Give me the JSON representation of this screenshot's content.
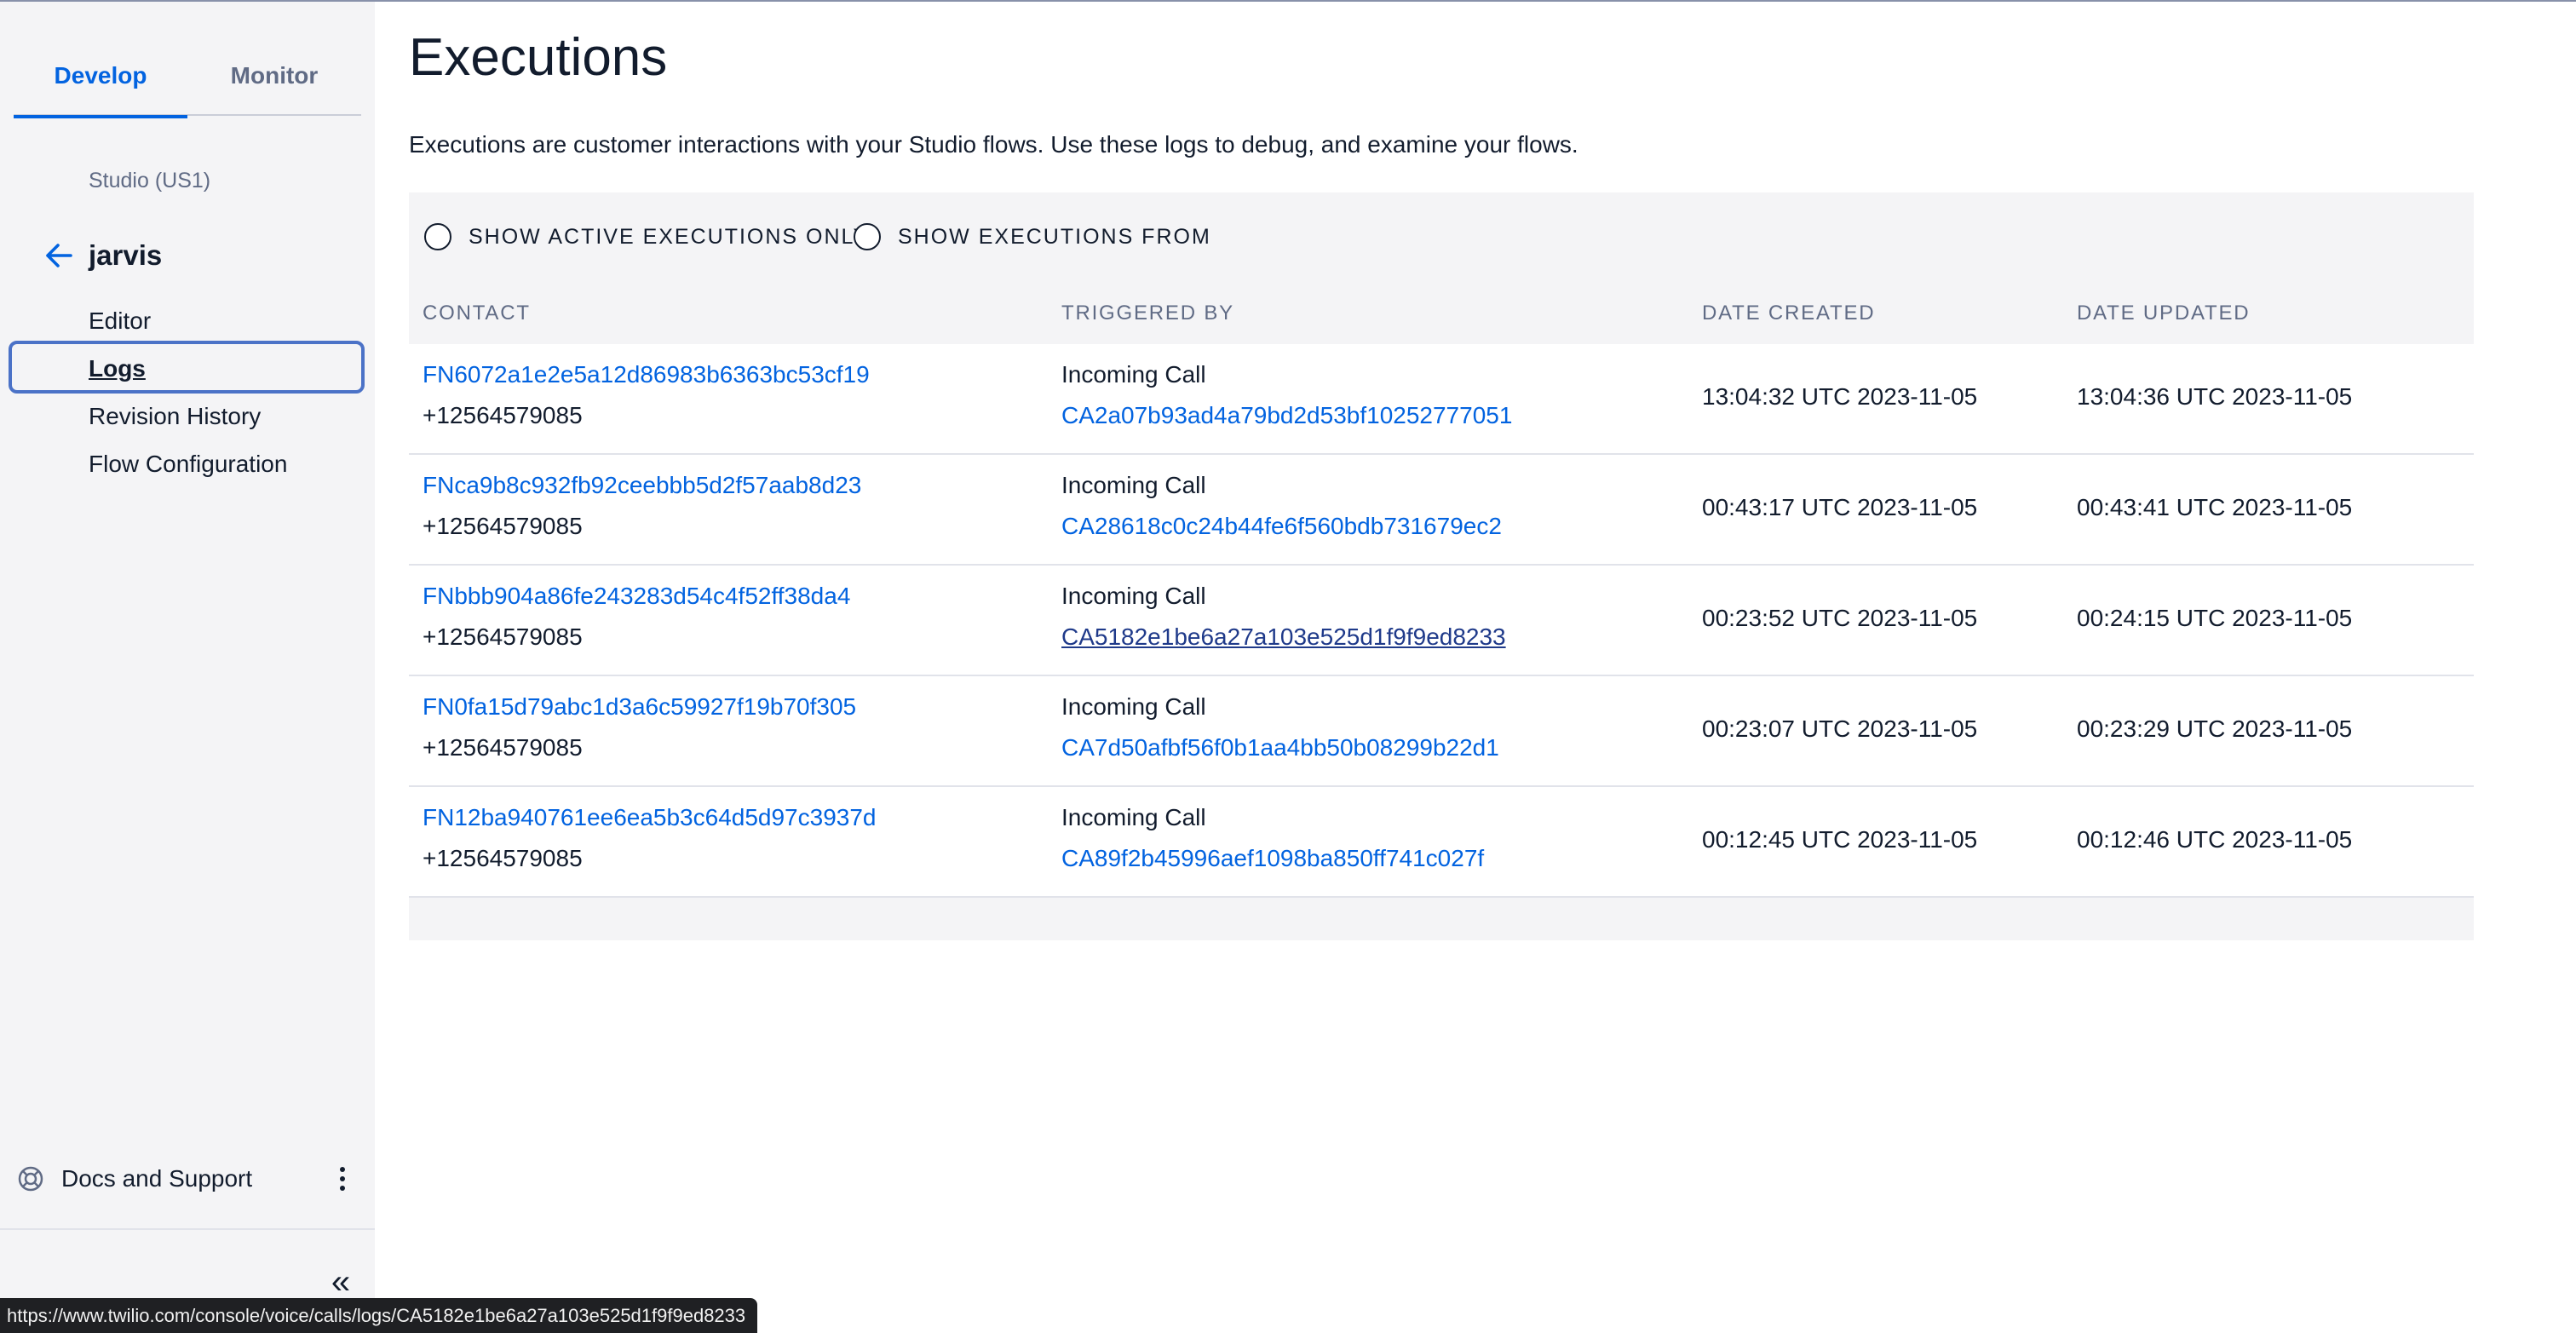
{
  "sidebar": {
    "tabs": [
      {
        "label": "Develop",
        "active": true
      },
      {
        "label": "Monitor",
        "active": false
      }
    ],
    "region": "Studio (US1)",
    "flow_name": "jarvis",
    "nav": [
      {
        "label": "Editor",
        "active": false
      },
      {
        "label": "Logs",
        "active": true
      },
      {
        "label": "Revision History",
        "active": false
      },
      {
        "label": "Flow Configuration",
        "active": false
      }
    ],
    "docs_label": "Docs and Support",
    "collapse_glyph": "«"
  },
  "main": {
    "title": "Executions",
    "description": "Executions are customer interactions with your Studio flows. Use these logs to debug, and examine your flows.",
    "filters": {
      "active_only": "SHOW ACTIVE EXECUTIONS ONLY",
      "from": "SHOW EXECUTIONS FROM"
    },
    "columns": [
      "CONTACT",
      "TRIGGERED BY",
      "DATE CREATED",
      "DATE UPDATED"
    ],
    "rows": [
      {
        "sid": "FN6072a1e2e5a12d86983b6363bc53cf19",
        "contact": "+12564579085",
        "trigger_type": "Incoming Call",
        "call_sid": "CA2a07b93ad4a79bd2d53bf10252777051",
        "created": "13:04:32 UTC 2023-11-05",
        "updated": "13:04:36 UTC 2023-11-05"
      },
      {
        "sid": "FNca9b8c932fb92ceebbb5d2f57aab8d23",
        "contact": "+12564579085",
        "trigger_type": "Incoming Call",
        "call_sid": "CA28618c0c24b44fe6f560bdb731679ec2",
        "created": "00:43:17 UTC 2023-11-05",
        "updated": "00:43:41 UTC 2023-11-05"
      },
      {
        "sid": "FNbbb904a86fe243283d54c4f52ff38da4",
        "contact": "+12564579085",
        "trigger_type": "Incoming Call",
        "call_sid": "CA5182e1be6a27a103e525d1f9f9ed8233",
        "created": "00:23:52 UTC 2023-11-05",
        "updated": "00:24:15 UTC 2023-11-05"
      },
      {
        "sid": "FN0fa15d79abc1d3a6c59927f19b70f305",
        "contact": "+12564579085",
        "trigger_type": "Incoming Call",
        "call_sid": "CA7d50afbf56f0b1aa4bb50b08299b22d1",
        "created": "00:23:07 UTC 2023-11-05",
        "updated": "00:23:29 UTC 2023-11-05"
      },
      {
        "sid": "FN12ba940761ee6ea5b3c64d5d97c3937d",
        "contact": "+12564579085",
        "trigger_type": "Incoming Call",
        "call_sid": "CA89f2b45996aef1098ba850ff741c027f",
        "created": "00:12:45 UTC 2023-11-05",
        "updated": "00:12:46 UTC 2023-11-05"
      }
    ]
  },
  "status_url": "https://www.twilio.com/console/voice/calls/logs/CA5182e1be6a27a103e525d1f9f9ed8233",
  "colors": {
    "accent": "#0263e0",
    "sidebar_bg": "#f4f4f6",
    "focus_ring": "#4b72c7"
  }
}
